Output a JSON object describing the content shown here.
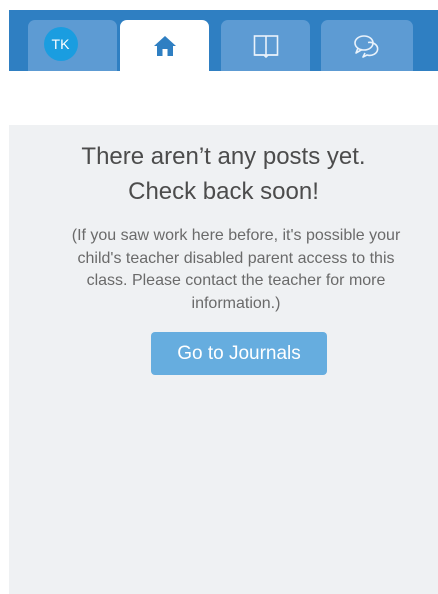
{
  "nav": {
    "avatar_initials": "TK",
    "tabs": [
      {
        "icon": "avatar",
        "active": false
      },
      {
        "icon": "home-icon",
        "active": true
      },
      {
        "icon": "journal-book-icon",
        "active": false
      },
      {
        "icon": "chat-bubbles-icon",
        "active": false
      }
    ]
  },
  "empty_state": {
    "heading_line1": "There aren’t any posts yet.",
    "heading_line2": "Check back soon!",
    "note": "(If you saw work here before, it's possible your child's teacher disabled parent access to this class. Please contact the teacher for more information.)",
    "button_label": "Go to Journals"
  },
  "colors": {
    "topbar": "#2f7fc2",
    "tab_inactive": "#5d9bd3",
    "tab_active": "#ffffff",
    "content_bg": "#eff1f3",
    "button_bg": "#66addf",
    "avatar_bg": "#1a9de0"
  }
}
